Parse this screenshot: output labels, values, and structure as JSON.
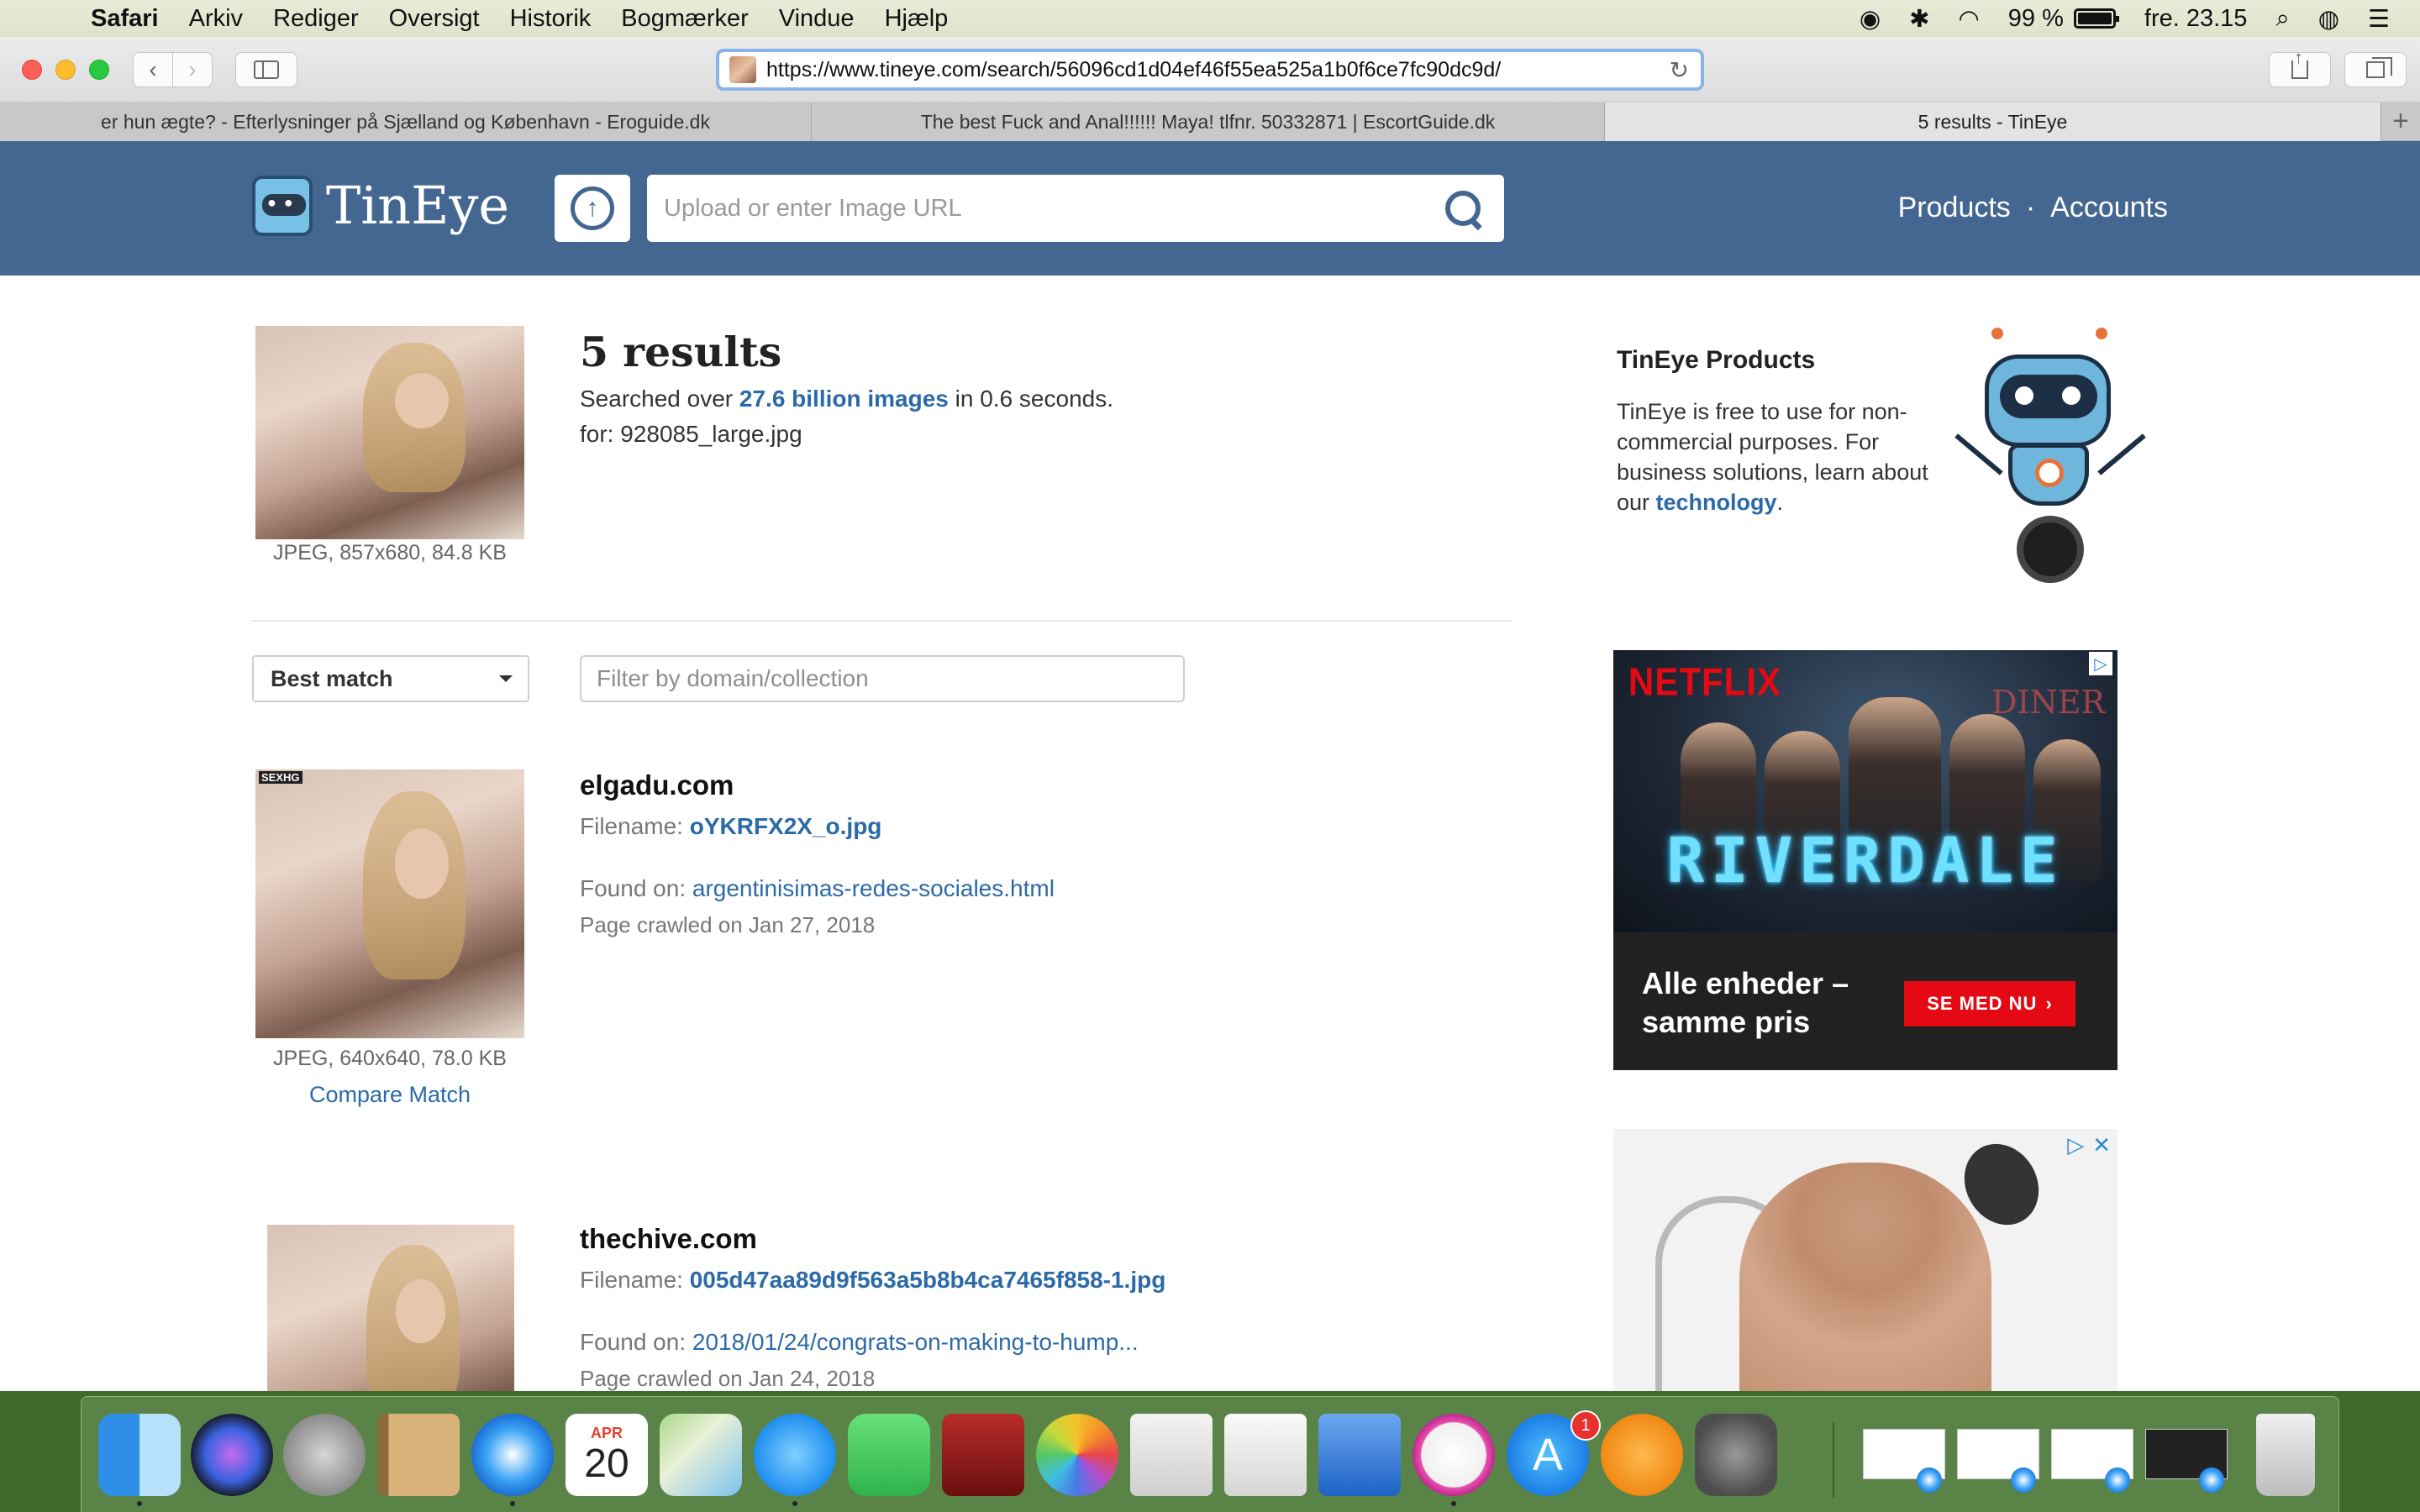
{
  "menubar": {
    "app_name": "Safari",
    "menus": [
      "Arkiv",
      "Rediger",
      "Oversigt",
      "Historik",
      "Bogmærker",
      "Vindue",
      "Hjælp"
    ],
    "battery_percent": "99 %",
    "clock": "fre. 23.15"
  },
  "browser": {
    "url": "https://www.tineye.com/search/56096cd1d04ef46f55ea525a1b0f6ce7fc90dc9d/",
    "tabs": [
      {
        "title": "er hun ægte? - Efterlysninger på Sjælland og København - Eroguide.dk",
        "active": false
      },
      {
        "title": "The best Fuck and Anal!!!!!! Maya! tlfnr. 50332871 | EscortGuide.dk",
        "active": false
      },
      {
        "title": "5 results - TinEye",
        "active": true
      }
    ],
    "new_tab_label": "+"
  },
  "site": {
    "logo_text": "TinEye",
    "search_placeholder": "Upload or enter Image URL",
    "nav": {
      "products": "Products",
      "separator": "·",
      "accounts": "Accounts"
    }
  },
  "query": {
    "image_meta": "JPEG, 857x680, 84.8 KB",
    "results_title": "5 results",
    "summary_prefix": "Searched over ",
    "summary_link": "27.6 billion images",
    "summary_suffix": " in 0.6 seconds.",
    "for_line": "for: 928085_large.jpg"
  },
  "controls": {
    "sort_value": "Best match",
    "filter_placeholder": "Filter by domain/collection"
  },
  "results": [
    {
      "domain": "elgadu.com",
      "filename_label": "Filename: ",
      "filename": "oYKRFX2X_o.jpg",
      "found_label": "Found on: ",
      "found_on": "argentinisimas-redes-sociales.html",
      "crawled": "Page crawled on Jan 27, 2018",
      "image_meta": "JPEG, 640x640, 78.0 KB",
      "compare": "Compare Match",
      "watermark": "SEXHG"
    },
    {
      "domain": "thechive.com",
      "filename_label": "Filename: ",
      "filename": "005d47aa89d9f563a5b8b4ca7465f858-1.jpg",
      "found_label": "Found on: ",
      "found_on": "2018/01/24/congrats-on-making-to-hump...",
      "crawled": "Page crawled on Jan 24, 2018"
    }
  ],
  "sidebar": {
    "products_title": "TinEye Products",
    "products_text": "TinEye is free to use for non-commercial purposes. For business solutions, learn about our ",
    "products_link": "technology",
    "products_end": "."
  },
  "ads": {
    "netflix": {
      "brand": "NETFLIX",
      "show": "RIVERDALE",
      "sign": "DINER",
      "tagline": "Alle enheder – samme pris",
      "cta": "SE MED NU",
      "brand_color": "#e50914"
    }
  },
  "dock": {
    "calendar_month": "APR",
    "calendar_day": "20",
    "appstore_badge": "1"
  },
  "colors": {
    "header_blue": "#446791",
    "link_blue": "#2c6aa7"
  }
}
